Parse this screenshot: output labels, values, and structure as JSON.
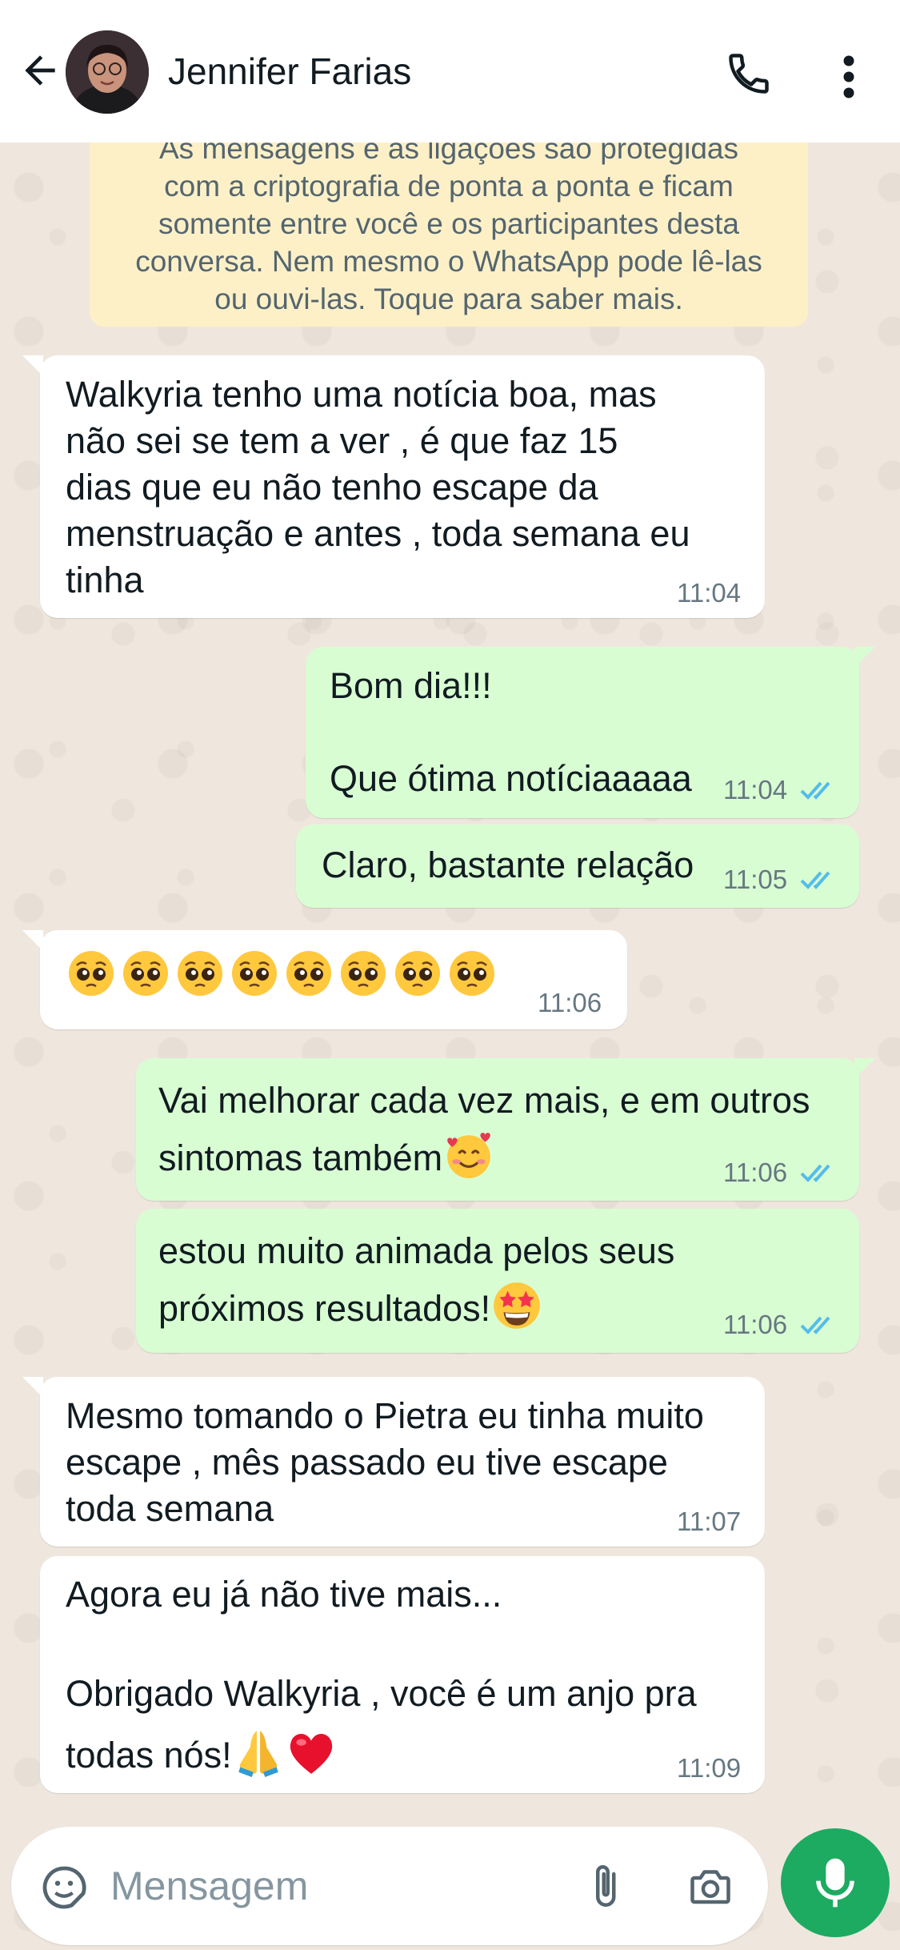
{
  "header": {
    "contact_name": "Jennifer Farias"
  },
  "encryption_notice": {
    "lines": [
      "As mensagens e as ligações são protegidas",
      "com a criptografia de ponta a ponta e ficam",
      "somente entre você e os participantes desta",
      "conversa. Nem mesmo o WhatsApp pode lê-las",
      "ou ouvi-las. Toque para saber mais."
    ]
  },
  "messages": [
    {
      "direction": "incoming",
      "lines": [
        "Walkyria tenho uma notícia boa, mas",
        "não sei se tem a ver , é que faz 15",
        "dias que eu não tenho escape da",
        "menstruação e antes , toda semana eu",
        "tinha"
      ],
      "time": "11:04"
    },
    {
      "direction": "outgoing",
      "lines": [
        "Bom dia!!!",
        "",
        "Que ótima notíciaaaaa"
      ],
      "time": "11:04",
      "status": "read"
    },
    {
      "direction": "outgoing",
      "lines": [
        "Claro, bastante relação"
      ],
      "time": "11:05",
      "status": "read"
    },
    {
      "direction": "incoming",
      "emoji": "pleading-face",
      "emoji_count": 8,
      "time": "11:06"
    },
    {
      "direction": "outgoing",
      "lines": [
        "Vai melhorar cada vez mais, e em outros",
        "sintomas também"
      ],
      "trailing_emoji": "smiling-face-with-hearts",
      "time": "11:06",
      "status": "read"
    },
    {
      "direction": "outgoing",
      "lines": [
        "estou muito animada pelos seus",
        "próximos resultados!"
      ],
      "trailing_emoji": "star-struck",
      "time": "11:06",
      "status": "read"
    },
    {
      "direction": "incoming",
      "lines": [
        "Mesmo tomando o Pietra eu tinha muito",
        "escape , mês passado eu tive escape",
        "toda semana"
      ],
      "time": "11:07"
    },
    {
      "direction": "incoming",
      "lines": [
        "Agora eu já não tive mais...",
        "",
        "Obrigado Walkyria , você é um anjo pra",
        "todas nós!"
      ],
      "trailing_emoji": [
        "folded-hands",
        "red-heart"
      ],
      "time": "11:09"
    }
  ],
  "composer": {
    "placeholder": "Mensagem"
  },
  "colors": {
    "incoming_bubble": "#ffffff",
    "outgoing_bubble": "#d9fdd3",
    "read_ticks": "#53bdeb",
    "mic_button": "#1daa61",
    "encryption_bg": "#fdf0c7"
  }
}
